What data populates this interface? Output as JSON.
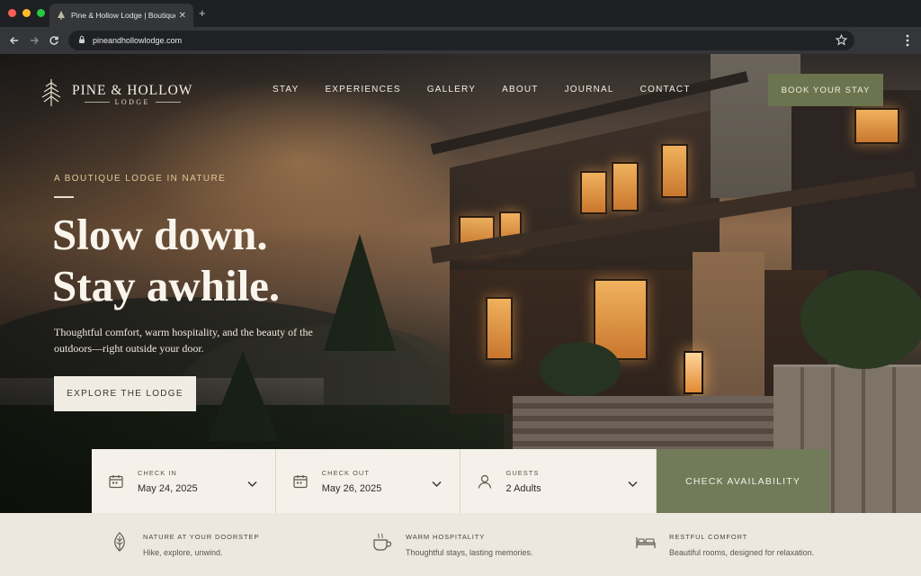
{
  "browser": {
    "tab_title": "Pine & Hollow Lodge | Boutique",
    "url": "pineandhollowlodge.com",
    "traffic_light_colors": [
      "#ff5f57",
      "#febc2e",
      "#28c840"
    ]
  },
  "brand": {
    "name": "PINE & HOLLOW",
    "sub": "LODGE",
    "accent": "#6b744e"
  },
  "nav": {
    "items": [
      "STAY",
      "EXPERIENCES",
      "GALLERY",
      "ABOUT",
      "JOURNAL",
      "CONTACT"
    ],
    "book_label": "BOOK YOUR STAY"
  },
  "hero": {
    "eyebrow": "A BOUTIQUE LODGE IN NATURE",
    "headline_line1": "Slow down.",
    "headline_line2": "Stay awhile.",
    "subtext": "Thoughtful comfort, warm hospitality, and the beauty of the outdoors—right outside your door.",
    "cta_label": "EXPLORE THE LODGE"
  },
  "booking": {
    "check_in": {
      "label": "CHECK IN",
      "value": "May 24, 2025",
      "icon": "calendar-icon"
    },
    "check_out": {
      "label": "CHECK OUT",
      "value": "May 26, 2025",
      "icon": "calendar-icon"
    },
    "guests": {
      "label": "GUESTS",
      "value": "2 Adults",
      "icon": "person-icon"
    },
    "submit_label": "CHECK AVAILABILITY"
  },
  "features": [
    {
      "title": "NATURE AT YOUR DOORSTEP",
      "desc": "Hike, explore, unwind.",
      "icon": "leaf-icon"
    },
    {
      "title": "WARM HOSPITALITY",
      "desc": "Thoughtful stays, lasting memories.",
      "icon": "coffee-cup-icon"
    },
    {
      "title": "RESTFUL COMFORT",
      "desc": "Beautiful rooms, designed for relaxation.",
      "icon": "bed-icon"
    }
  ]
}
